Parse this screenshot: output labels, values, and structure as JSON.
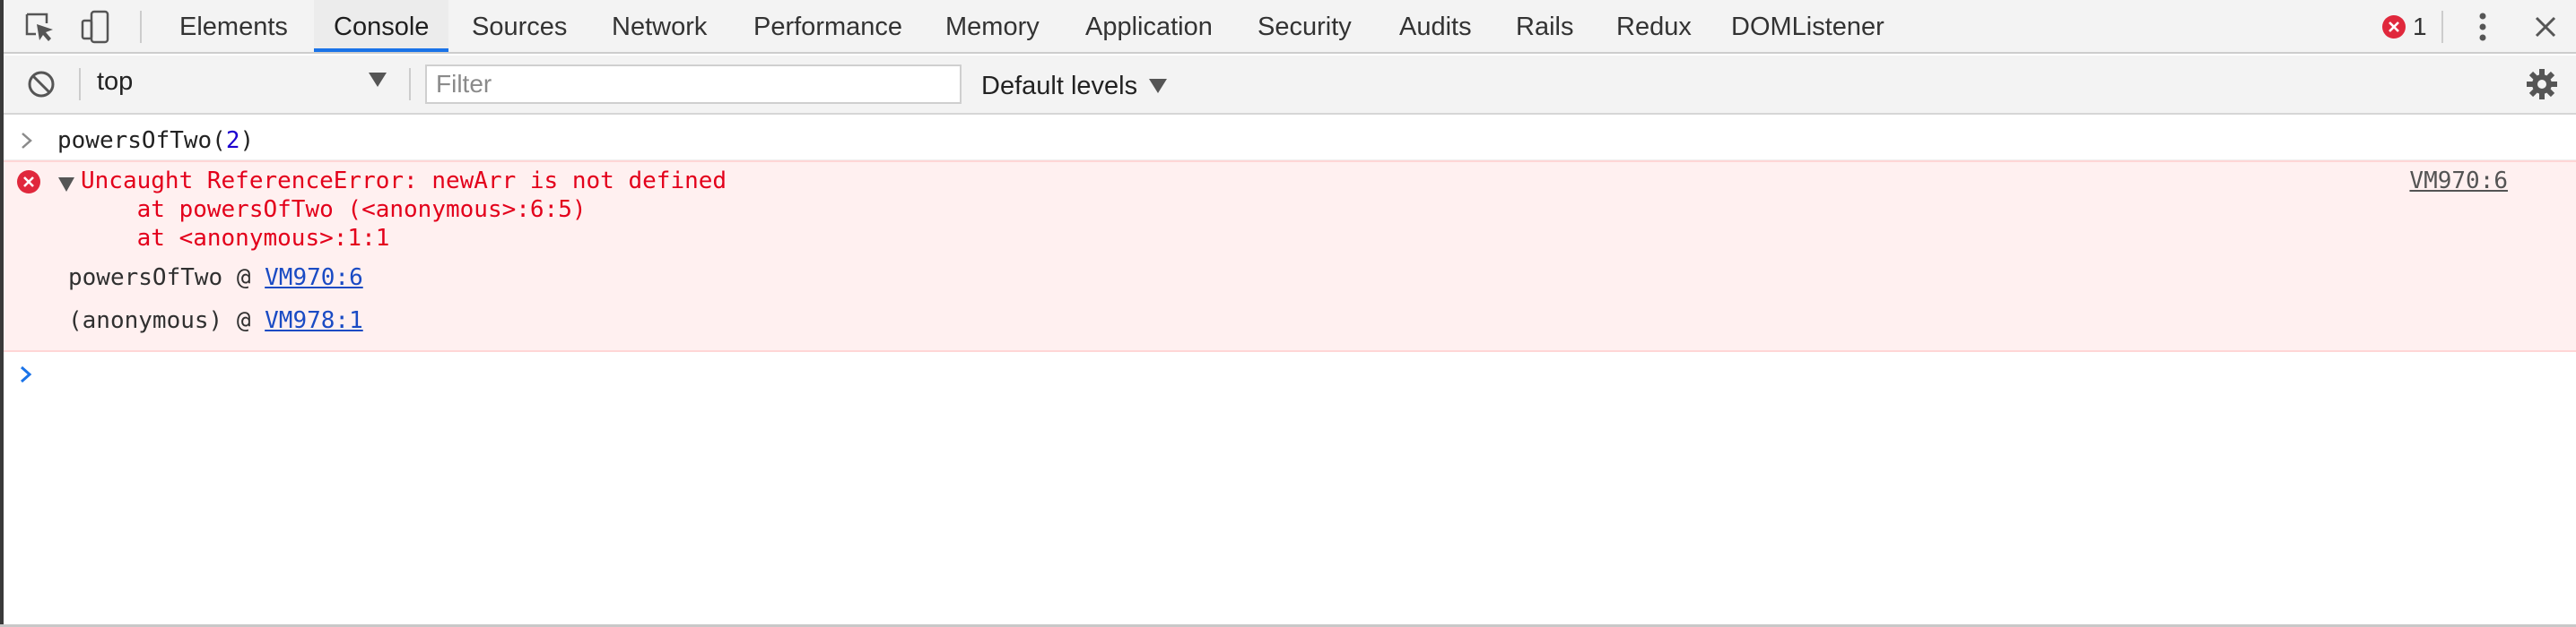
{
  "tabbar": {
    "tabs": [
      "Elements",
      "Console",
      "Sources",
      "Network",
      "Performance",
      "Memory",
      "Application",
      "Security",
      "Audits",
      "Rails",
      "Redux",
      "DOMListener"
    ],
    "selected_tab": "Console",
    "error_count": "1",
    "icons": [
      "inspect-element-icon",
      "device-toolbar-icon",
      "error-icon",
      "kebab-menu-icon",
      "close-icon"
    ]
  },
  "toolbar": {
    "context": "top",
    "filter_placeholder": "Filter",
    "filter_value": "",
    "levels_label": "Default levels",
    "icons": [
      "clear-console-icon",
      "dropdown-arrow-icon",
      "settings-gear-icon"
    ]
  },
  "console": {
    "input": {
      "code_prefix": "powersOfTwo(",
      "code_arg": "2",
      "code_suffix": ")"
    },
    "error": {
      "message": "Uncaught ReferenceError: newArr is not defined",
      "stack_lines": [
        "    at powersOfTwo (<anonymous>:6:5)",
        "    at <anonymous>:1:1"
      ],
      "source_link": "VM970:6",
      "frames": [
        {
          "function": "powersOfTwo",
          "at": "@",
          "link": "VM970:6"
        },
        {
          "function": "(anonymous)",
          "at": "@",
          "link": "VM978:1"
        }
      ]
    }
  },
  "colors": {
    "accent": "#1a73e8",
    "error_text": "#e3001b",
    "error_bg": "#fff0f0",
    "error_badge": "#e0283c",
    "link": "#1a4bc4"
  }
}
